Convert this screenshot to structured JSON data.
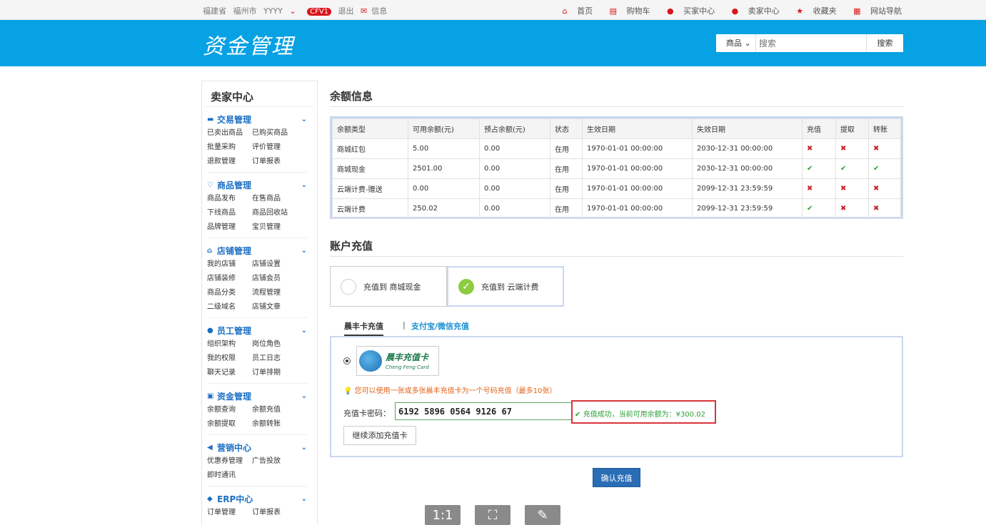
{
  "topbar": {
    "province": "福建省",
    "city": "福州市",
    "user": "YYYY",
    "user_chevron": "⌄",
    "level_badge": "CFV1",
    "logout": "退出",
    "messages": "信息",
    "home": "首页",
    "cart": "购物车",
    "buyer_center": "买家中心",
    "seller_center": "卖家中心",
    "favorites": "收藏夹",
    "site_nav": "网站导航"
  },
  "header": {
    "logo": "资金管理",
    "search_category": "商品",
    "search_placeholder": "搜索",
    "search_button": "搜索"
  },
  "sidebar": {
    "title": "卖家中心",
    "groups": [
      {
        "title": "交易管理",
        "items": [
          "已卖出商品",
          "已购买商品",
          "批量采购",
          "评价管理",
          "退款管理",
          "订单报表"
        ]
      },
      {
        "title": "商品管理",
        "items": [
          "商品发布",
          "在售商品",
          "下线商品",
          "商品回收站",
          "品牌管理",
          "宝贝管理"
        ]
      },
      {
        "title": "店铺管理",
        "items": [
          "我的店铺",
          "店铺设置",
          "店铺装修",
          "店铺会员",
          "商品分类",
          "流程管理",
          "二级域名",
          "店铺文章"
        ]
      },
      {
        "title": "员工管理",
        "items": [
          "组织架构",
          "岗位角色",
          "我的权限",
          "员工日志",
          "聊天记录",
          "订单排期"
        ]
      },
      {
        "title": "资金管理",
        "items": [
          "余额查询",
          "余额充值",
          "余额提取",
          "余额转账"
        ]
      },
      {
        "title": "营销中心",
        "items": [
          "优惠券管理",
          "广告投放",
          "即时通讯"
        ]
      },
      {
        "title": "ERP中心",
        "items": [
          "订单管理",
          "订单报表"
        ]
      }
    ]
  },
  "balance": {
    "title": "余额信息",
    "headers": [
      "余额类型",
      "可用余额(元)",
      "预占余额(元)",
      "状态",
      "生效日期",
      "失效日期",
      "充值",
      "提取",
      "转账"
    ],
    "rows": [
      [
        "商城红包",
        "5.00",
        "0.00",
        "在用",
        "1970-01-01 00:00:00",
        "2030-12-31 00:00:00",
        "✖",
        "✖",
        "✖"
      ],
      [
        "商城现金",
        "2501.00",
        "0.00",
        "在用",
        "1970-01-01 00:00:00",
        "2030-12-31 00:00:00",
        "✔",
        "✔",
        "✔"
      ],
      [
        "云端计费-赠送",
        "0.00",
        "0.00",
        "在用",
        "1970-01-01 00:00:00",
        "2099-12-31 23:59:59",
        "✖",
        "✖",
        "✖"
      ],
      [
        "云端计费",
        "250.02",
        "0.00",
        "在用",
        "1970-01-01 00:00:00",
        "2099-12-31 23:59:59",
        "✔",
        "✖",
        "✖"
      ]
    ]
  },
  "recharge": {
    "title": "账户充值",
    "option_mall_cash": "充值到 商城现金",
    "option_cloud": "充值到 云端计费",
    "tab_card": "晨丰卡充值",
    "tab_separator": "|",
    "tab_alipay": "支付宝/微信充值",
    "card_logo_title": "晨丰充值卡",
    "card_logo_sub": "Cheng Feng Card",
    "tip": "您可以使用一张或多张晨丰充值卡为一个号码充值（最多10张）",
    "password_label": "充值卡密码：",
    "password_value": "6192 5896 0564 9126 67",
    "status": "充值成功，当前可用余额为：¥300.02",
    "add_card": "继续添加充值卡",
    "confirm": "确认充值"
  },
  "tools": [
    "1:1",
    "⛶",
    "✎"
  ],
  "colors": {
    "header_blue": "#06a2e4",
    "link_blue": "#1a6fc4",
    "success_green": "#2e9d3a",
    "error_red": "#c8202a",
    "alert_border": "#d9343a"
  }
}
